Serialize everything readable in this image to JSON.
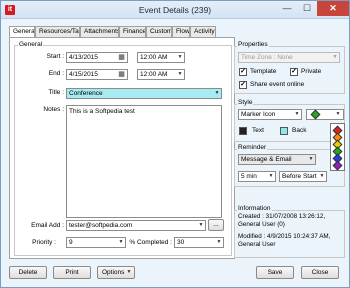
{
  "window": {
    "title": "Event Details (239)",
    "app_icon": "it",
    "min": "—",
    "max": "☐",
    "close": "✕"
  },
  "tabs": [
    "General",
    "Resources/Tasks",
    "Attachments",
    "Finance",
    "Custom",
    "Flow",
    "Activity"
  ],
  "general": {
    "legend": "General",
    "start_label": "Start :",
    "start_date": "4/13/2015",
    "start_time": "12:00 AM",
    "end_label": "End :",
    "end_date": "4/15/2015",
    "end_time": "12:00 AM",
    "title_label": "Title :",
    "title_value": "Conference",
    "notes_label": "Notes :",
    "notes_value": "This is a Softpedia test",
    "email_label": "Email Add :",
    "email_value": "tester@softpedia.com",
    "email_more": "...",
    "priority_label": "Priority :",
    "priority_value": "9",
    "completed_label": "% Completed :",
    "completed_value": "30"
  },
  "properties": {
    "legend": "Properties",
    "timezone_placeholder": "Time Zone : None",
    "template_label": "Template",
    "private_label": "Private",
    "share_label": "Share event online"
  },
  "style": {
    "legend": "Style",
    "marker_value": "Marker Icon",
    "text_label": "Text",
    "back_label": "Back",
    "colors": {
      "text": "#222222",
      "back": "#8fe6e6",
      "selected_marker": "#22aa22"
    },
    "marker_options": [
      "#e02020",
      "#ff8c00",
      "#e0d000",
      "#22aa22",
      "#2040e0",
      "#9020c0"
    ]
  },
  "reminder": {
    "legend": "Reminder",
    "type_value": "Message & Email",
    "amount_value": "5 min",
    "when_value": "Before Start"
  },
  "information": {
    "legend": "Information",
    "created": "Created : 31/07/2008 13:26:12, General User (0)",
    "modified": "Modified : 4/9/2015 10:24:37 AM, General User"
  },
  "buttons": {
    "delete": "Delete",
    "print": "Print",
    "options": "Options",
    "save": "Save",
    "close": "Close"
  }
}
